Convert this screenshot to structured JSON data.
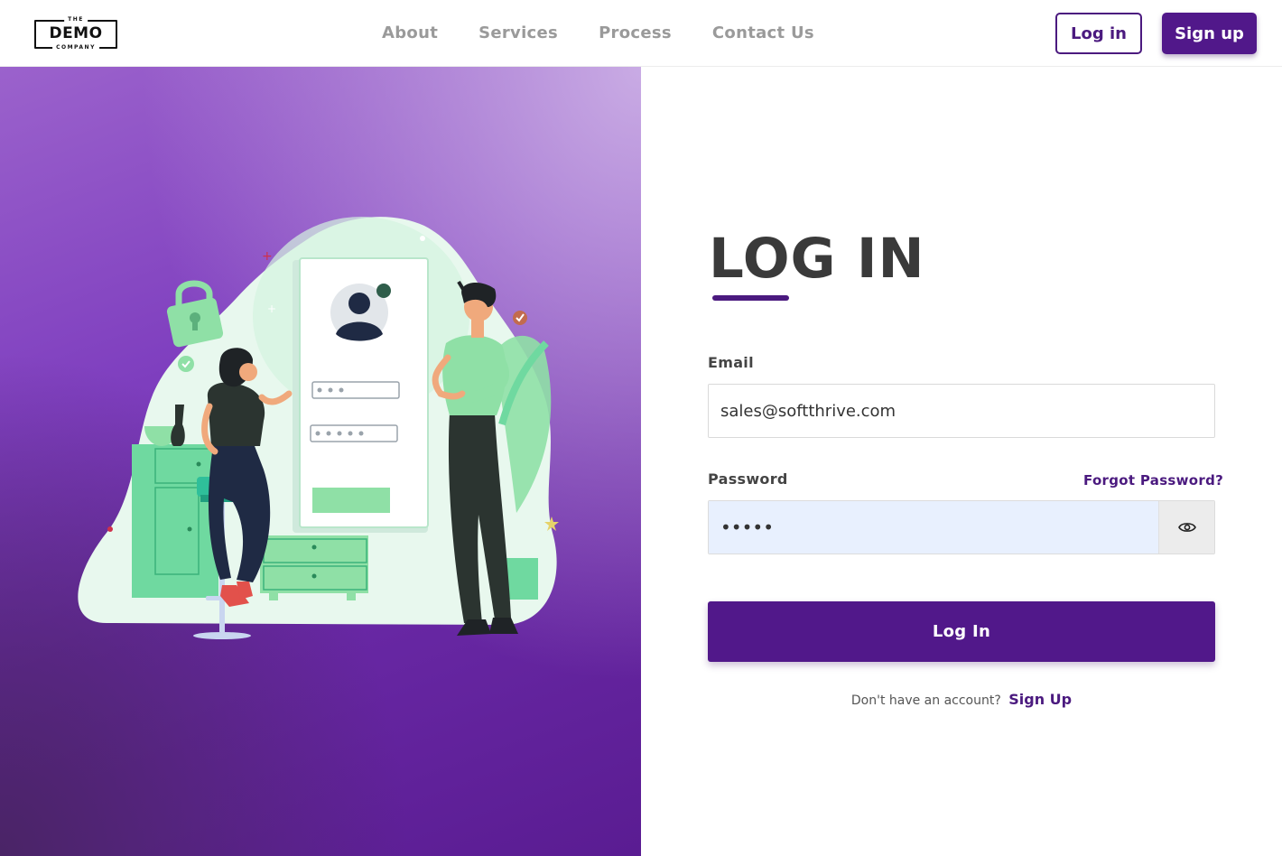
{
  "brand": {
    "logo_top": "THE",
    "logo_main": "DEMO",
    "logo_bottom": "COMPANY"
  },
  "nav": {
    "items": [
      {
        "label": "About"
      },
      {
        "label": "Services"
      },
      {
        "label": "Process"
      },
      {
        "label": "Contact Us"
      }
    ]
  },
  "header_actions": {
    "login_label": "Log in",
    "signup_label": "Sign up"
  },
  "form": {
    "title": "LOG IN",
    "email_label": "Email",
    "email_value": "sales@softthrive.com",
    "password_label": "Password",
    "forgot_label": "Forgot Password?",
    "password_value": "•••••",
    "submit_label": "Log In",
    "no_account_text": "Don't have an account?",
    "signup_link_label": "Sign Up"
  },
  "icons": {
    "password_toggle": "eye-icon",
    "hero_lock": "padlock-icon",
    "hero_avatar": "user-avatar-icon"
  },
  "colors": {
    "brand_purple": "#51188a",
    "accent_green": "#8fe0a6",
    "autofill_blue": "#e8f0fe"
  }
}
